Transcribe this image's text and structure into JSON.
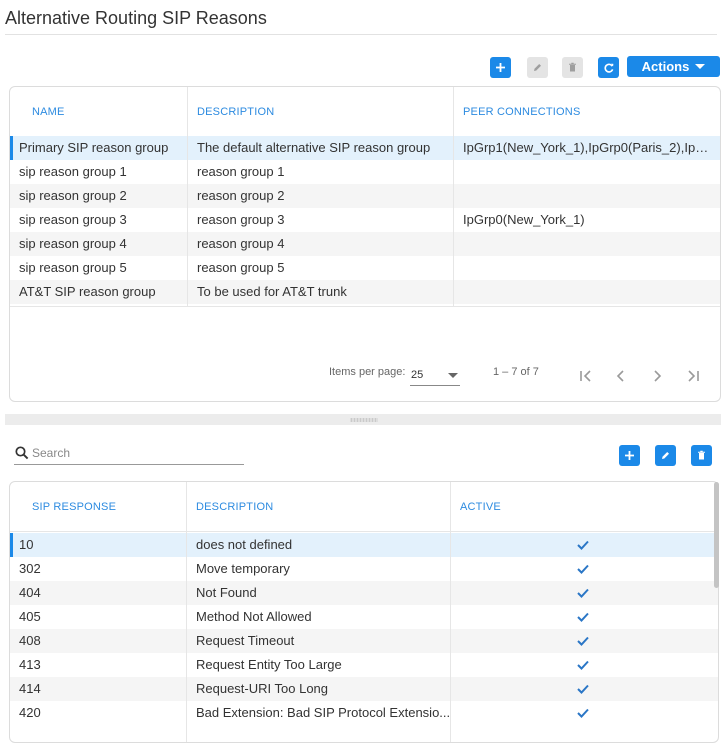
{
  "page": {
    "title": "Alternative Routing SIP Reasons"
  },
  "top_toolbar": {
    "actions_label": "Actions"
  },
  "groups_table": {
    "columns": [
      "NAME",
      "DESCRIPTION",
      "PEER CONNECTIONS"
    ],
    "rows": [
      {
        "name": "Primary SIP reason group",
        "description": "The default alternative SIP reason group",
        "peer": "IpGrp1(New_York_1),IpGrp0(Paris_2),IpGrp..."
      },
      {
        "name": "sip reason group 1",
        "description": "reason group 1",
        "peer": ""
      },
      {
        "name": "sip reason group 2",
        "description": "reason group 2",
        "peer": ""
      },
      {
        "name": "sip reason group 3",
        "description": "reason group 3",
        "peer": "IpGrp0(New_York_1)"
      },
      {
        "name": "sip reason group 4",
        "description": "reason group 4",
        "peer": ""
      },
      {
        "name": "sip reason group 5",
        "description": "reason group 5",
        "peer": ""
      },
      {
        "name": "AT&T SIP reason group",
        "description": "To be used for AT&T trunk",
        "peer": ""
      }
    ]
  },
  "pagination": {
    "items_per_page_label": "Items per page:",
    "items_per_page_value": "25",
    "range": "1 – 7 of 7"
  },
  "search": {
    "placeholder": "Search"
  },
  "responses_table": {
    "columns": [
      "SIP RESPONSE",
      "DESCRIPTION",
      "ACTIVE"
    ],
    "rows": [
      {
        "code": "10",
        "description": "does not defined",
        "active": true
      },
      {
        "code": "302",
        "description": "Move temporary",
        "active": true
      },
      {
        "code": "404",
        "description": "Not Found",
        "active": true
      },
      {
        "code": "405",
        "description": "Method Not Allowed",
        "active": true
      },
      {
        "code": "408",
        "description": "Request Timeout",
        "active": true
      },
      {
        "code": "413",
        "description": "Request Entity Too Large",
        "active": true
      },
      {
        "code": "414",
        "description": "Request-URI Too Long",
        "active": true
      },
      {
        "code": "420",
        "description": "Bad Extension: Bad SIP Protocol Extensio...",
        "active": true
      }
    ]
  },
  "colors": {
    "accent": "#1b89e8",
    "selected_row": "#e3f1fc",
    "header_text": "#2d8be0"
  }
}
